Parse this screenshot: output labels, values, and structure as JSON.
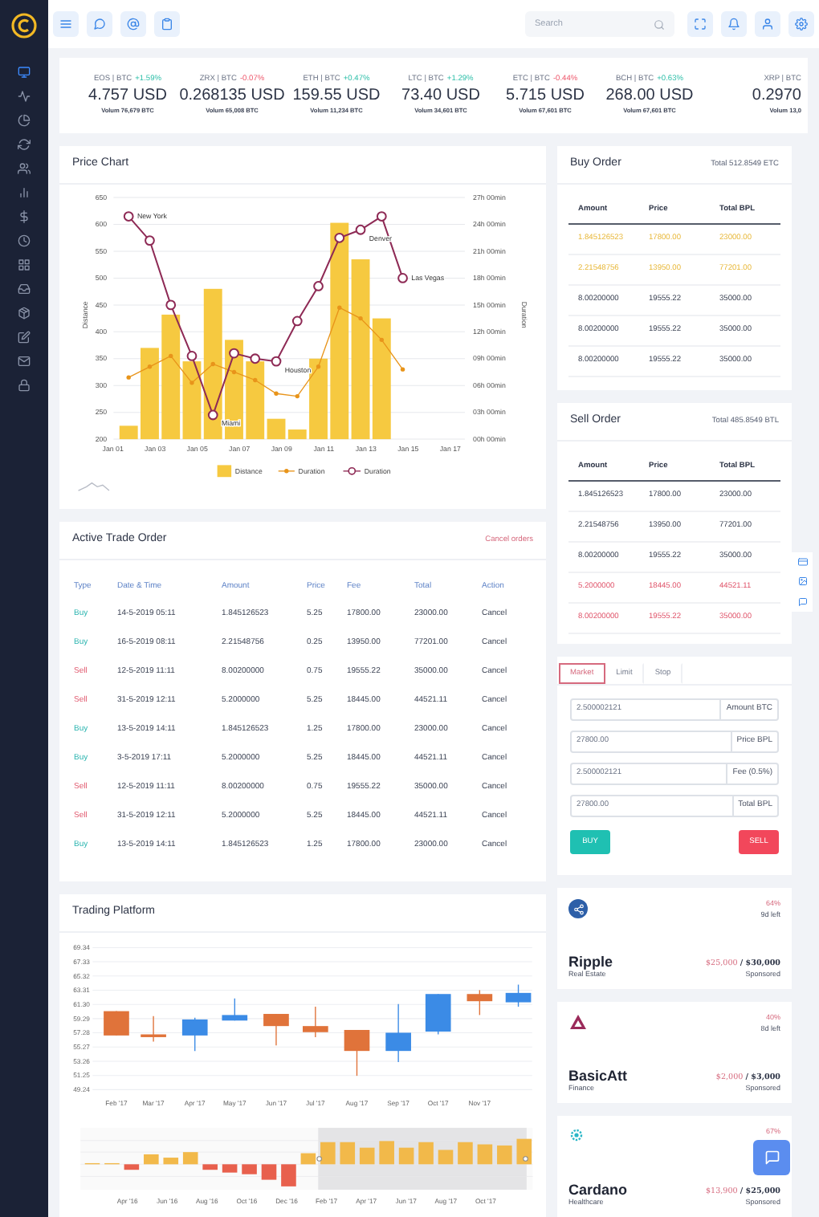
{
  "sidebar": {
    "items": [
      {
        "selected": true
      },
      {
        "selected": false
      },
      {
        "selected": false
      },
      {
        "selected": false
      },
      {
        "selected": false
      },
      {
        "selected": false
      },
      {
        "selected": false
      },
      {
        "selected": false
      },
      {
        "selected": false
      },
      {
        "selected": false
      },
      {
        "selected": false
      },
      {
        "selected": false
      },
      {
        "selected": false
      },
      {
        "selected": false
      }
    ]
  },
  "topbar": {
    "search": {
      "placeholder": "Search"
    }
  },
  "tickers": [
    {
      "pair": "EOS | BTC",
      "change": "+1.59%",
      "kind": "up",
      "price": "4.757 USD",
      "volume": "Volum 76,679 BTC"
    },
    {
      "pair": "ZRX | BTC",
      "change": "-0.07%",
      "kind": "down",
      "price": "0.268135 USD",
      "volume": "Volum 65,008 BTC"
    },
    {
      "pair": "ETH | BTC",
      "change": "+0.47%",
      "kind": "up",
      "price": "159.55 USD",
      "volume": "Volum 11,234 BTC"
    },
    {
      "pair": "LTC | BTC",
      "change": "+1.29%",
      "kind": "up",
      "price": "73.40 USD",
      "volume": "Volum 34,601 BTC"
    },
    {
      "pair": "ETC | BTC",
      "change": "-0.44%",
      "kind": "down",
      "price": "5.715 USD",
      "volume": "Volum 67,601 BTC"
    },
    {
      "pair": "BCH | BTC",
      "change": "+0.63%",
      "kind": "up",
      "price": "268.00 USD",
      "volume": "Volum 67,601 BTC"
    },
    {
      "pair": "XRP | BTC",
      "price": "0.2970",
      "volume": "Volum 13,0"
    }
  ],
  "price_chart": {
    "title": "Price Chart",
    "chart_data": {
      "type": "bar",
      "ylabel": "Distance",
      "categories": [
        "Jan 01",
        null,
        "Jan 03",
        null,
        "Jan 05",
        null,
        "Jan 07",
        null,
        "Jan 09",
        null,
        "Jan 11",
        null,
        "Jan 13",
        null,
        "Jan 15",
        null,
        "Jan 17"
      ],
      "grid": true,
      "legend": "bottom",
      "ylim": [
        200,
        650
      ],
      "yticks": [
        200,
        250,
        300,
        350,
        400,
        450,
        500,
        550,
        600,
        650
      ],
      "series": [
        {
          "name": "Distance",
          "color": "#f6c940",
          "values": [
            null,
            225,
            370,
            432,
            345,
            480,
            385,
            345,
            238,
            218,
            350,
            603,
            535,
            425,
            null,
            null,
            null
          ]
        },
        {
          "name": "Duration",
          "type": "line",
          "color": "#e8941a",
          "values": [
            null,
            315,
            335,
            355,
            305,
            340,
            325,
            310,
            285,
            280,
            335,
            445,
            425,
            385,
            330,
            null,
            null
          ]
        },
        {
          "name": "Duration",
          "type": "line",
          "marker": "circle",
          "color": "#8e2a55",
          "values": [
            null,
            615,
            570,
            450,
            355,
            245,
            360,
            350,
            345,
            420,
            485,
            575,
            590,
            615,
            500,
            null,
            null
          ],
          "value_labels": [
            null,
            "New York",
            null,
            null,
            null,
            "Miami",
            null,
            null,
            "Houston",
            null,
            null,
            null,
            "Denver",
            null,
            "Las Vegas",
            null,
            null
          ]
        }
      ]
    },
    "right_axis": {
      "label": "Duration",
      "ticks": [
        "27h 00min",
        "24h 00min",
        "21h 00min",
        "18h 00min",
        "15h 00min",
        "12h 00min",
        "09h 00min",
        "06h 00min",
        "03h 00min",
        "00h 00min"
      ]
    }
  },
  "active_trade_order": {
    "title": "Active Trade Order",
    "action": "Cancel orders",
    "columns": [
      "Type",
      "Date & Time",
      "Amount",
      "Price",
      "Fee",
      "Total",
      "Action"
    ],
    "rows": [
      {
        "kind": "buy",
        "type": "Buy",
        "date": "14-5-2019 05:11",
        "amount": "1.845126523",
        "price": "5.25",
        "fee": "17800.00",
        "total": "23000.00",
        "action": "Cancel"
      },
      {
        "kind": "buy",
        "type": "Buy",
        "date": "16-5-2019 08:11",
        "amount": "2.21548756",
        "price": "0.25",
        "fee": "13950.00",
        "total": "77201.00",
        "action": "Cancel"
      },
      {
        "kind": "sell",
        "type": "Sell",
        "date": "12-5-2019 11:11",
        "amount": "8.00200000",
        "price": "0.75",
        "fee": "19555.22",
        "total": "35000.00",
        "action": "Cancel"
      },
      {
        "kind": "sell",
        "type": "Sell",
        "date": "31-5-2019 12:11",
        "amount": "5.2000000",
        "price": "5.25",
        "fee": "18445.00",
        "total": "44521.11",
        "action": "Cancel"
      },
      {
        "kind": "buy",
        "type": "Buy",
        "date": "13-5-2019 14:11",
        "amount": "1.845126523",
        "price": "1.25",
        "fee": "17800.00",
        "total": "23000.00",
        "action": "Cancel"
      },
      {
        "kind": "buy",
        "type": "Buy",
        "date": "3-5-2019 17:11",
        "amount": "5.2000000",
        "price": "5.25",
        "fee": "18445.00",
        "total": "44521.11",
        "action": "Cancel"
      },
      {
        "kind": "sell",
        "type": "Sell",
        "date": "12-5-2019 11:11",
        "amount": "8.00200000",
        "price": "0.75",
        "fee": "19555.22",
        "total": "35000.00",
        "action": "Cancel"
      },
      {
        "kind": "sell",
        "type": "Sell",
        "date": "31-5-2019 12:11",
        "amount": "5.2000000",
        "price": "5.25",
        "fee": "18445.00",
        "total": "44521.11",
        "action": "Cancel"
      },
      {
        "kind": "buy",
        "type": "Buy",
        "date": "13-5-2019 14:11",
        "amount": "1.845126523",
        "price": "1.25",
        "fee": "17800.00",
        "total": "23000.00",
        "action": "Cancel"
      }
    ]
  },
  "trading_platform": {
    "title": "Trading Platform",
    "yticks": [
      "69.34",
      "67.33",
      "65.32",
      "63.31",
      "61.30",
      "59.29",
      "57.28",
      "55.27",
      "53.26",
      "51.25",
      "49.24"
    ],
    "xticks": [
      "Feb '17",
      "Mar '17",
      "Apr '17",
      "May '17",
      "Jun '17",
      "Jul '17",
      "Aug '17",
      "Sep '17",
      "Oct '17",
      "Nov '17"
    ],
    "navigator_ticks": [
      "Apr '16",
      "Jun '16",
      "Aug '16",
      "Oct '16",
      "Dec '16",
      "Feb '17",
      "Apr '17",
      "Jun '17",
      "Aug '17",
      "Oct '17"
    ]
  },
  "buy_order": {
    "title": "Buy Order",
    "total": "Total 512.8549 ETC",
    "columns": [
      "Amount",
      "Price",
      "Total BPL"
    ],
    "rows": [
      {
        "kind": "highlighted",
        "cells": [
          "1.845126523",
          "17800.00",
          "23000.00"
        ]
      },
      {
        "kind": "highlighted",
        "cells": [
          "2.21548756",
          "13950.00",
          "77201.00"
        ]
      },
      {
        "kind": "normal",
        "cells": [
          "8.00200000",
          "19555.22",
          "35000.00"
        ]
      },
      {
        "kind": "normal",
        "cells": [
          "8.00200000",
          "19555.22",
          "35000.00"
        ]
      },
      {
        "kind": "normal",
        "cells": [
          "8.00200000",
          "19555.22",
          "35000.00"
        ]
      }
    ]
  },
  "sell_order": {
    "title": "Sell Order",
    "total": "Total 485.8549 BTL",
    "columns": [
      "Amount",
      "Price",
      "Total BPL"
    ],
    "rows": [
      {
        "kind": "normal",
        "cells": [
          "1.845126523",
          "17800.00",
          "23000.00"
        ]
      },
      {
        "kind": "normal",
        "cells": [
          "2.21548756",
          "13950.00",
          "77201.00"
        ]
      },
      {
        "kind": "normal",
        "cells": [
          "8.00200000",
          "19555.22",
          "35000.00"
        ]
      },
      {
        "kind": "alert",
        "cells": [
          "5.2000000",
          "18445.00",
          "44521.11"
        ]
      },
      {
        "kind": "alert",
        "cells": [
          "8.00200000",
          "19555.22",
          "35000.00"
        ]
      }
    ]
  },
  "order_form": {
    "tabs": [
      {
        "label": "Market",
        "selected": true
      },
      {
        "label": "Limit",
        "selected": false
      },
      {
        "label": "Stop",
        "selected": false
      }
    ],
    "fields": [
      {
        "value": "2.500002121",
        "unit": "Amount BTC"
      },
      {
        "value": "27800.00",
        "unit": "Price BPL"
      },
      {
        "value": "2.500002121",
        "unit": "Fee (0.5%)"
      },
      {
        "value": "27800.00",
        "unit": "Total BPL"
      }
    ],
    "buttons": [
      {
        "kind": "buy",
        "label": "BUY"
      },
      {
        "kind": "sell",
        "label": "SELL"
      }
    ]
  },
  "sponsors": [
    {
      "percent": "64%",
      "days_left": "9d left",
      "name": "Ripple",
      "category": "Real Estate",
      "raised": "$25,000",
      "goal": "/ $30,000",
      "tag": "Sponsored"
    },
    {
      "percent": "40%",
      "days_left": "8d left",
      "name": "BasicAtt",
      "category": "Finance",
      "raised": "$2,000",
      "goal": "/ $3,000",
      "tag": "Sponsored"
    },
    {
      "percent": "67%",
      "name": "Cardano",
      "category": "Healthcare",
      "raised": "$13,900",
      "goal": "/ $25,000",
      "tag": "Sponsored"
    }
  ]
}
